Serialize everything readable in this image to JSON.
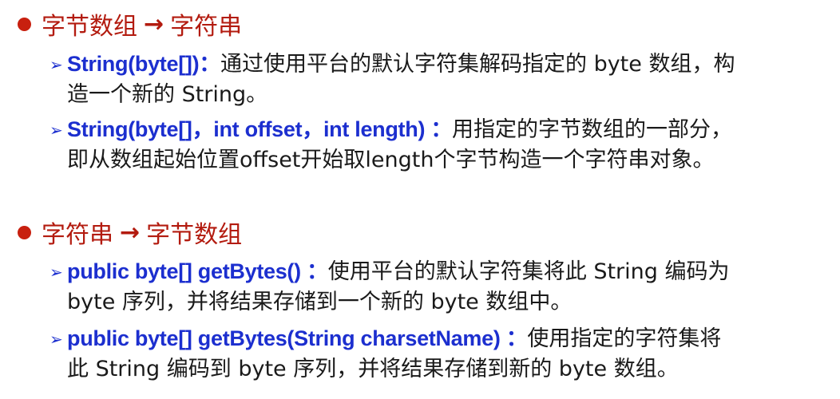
{
  "sections": [
    {
      "heading": {
        "from": "字节数组",
        "arrow": "→",
        "to": "字符串"
      },
      "items": [
        {
          "marker": "➢",
          "signature": "String(byte[])：",
          "line1": "通过使用平台的默认字符集解码指定的 byte 数组，构",
          "line2": "造一个新的 String。"
        },
        {
          "marker": "➢",
          "signature": "String(byte[]，int offset，int length) ：",
          "line1": "用指定的字节数组的一部分，",
          "line2": "即从数组起始位置offset开始取length个字节构造一个字符串对象。"
        }
      ]
    },
    {
      "heading": {
        "from": "字符串",
        "arrow": "→",
        "to": "字节数组"
      },
      "items": [
        {
          "marker": "➢",
          "signature": "public byte[] getBytes() ：",
          "line1": "使用平台的默认字符集将此 String 编码为",
          "line2": "byte 序列，并将结果存储到一个新的 byte 数组中。"
        },
        {
          "marker": "➢",
          "signature": "public byte[] getBytes(String charsetName) ：",
          "line1": "使用指定的字符集将",
          "line2": "此 String 编码到 byte 序列，并将结果存储到新的 byte 数组。"
        }
      ]
    }
  ]
}
